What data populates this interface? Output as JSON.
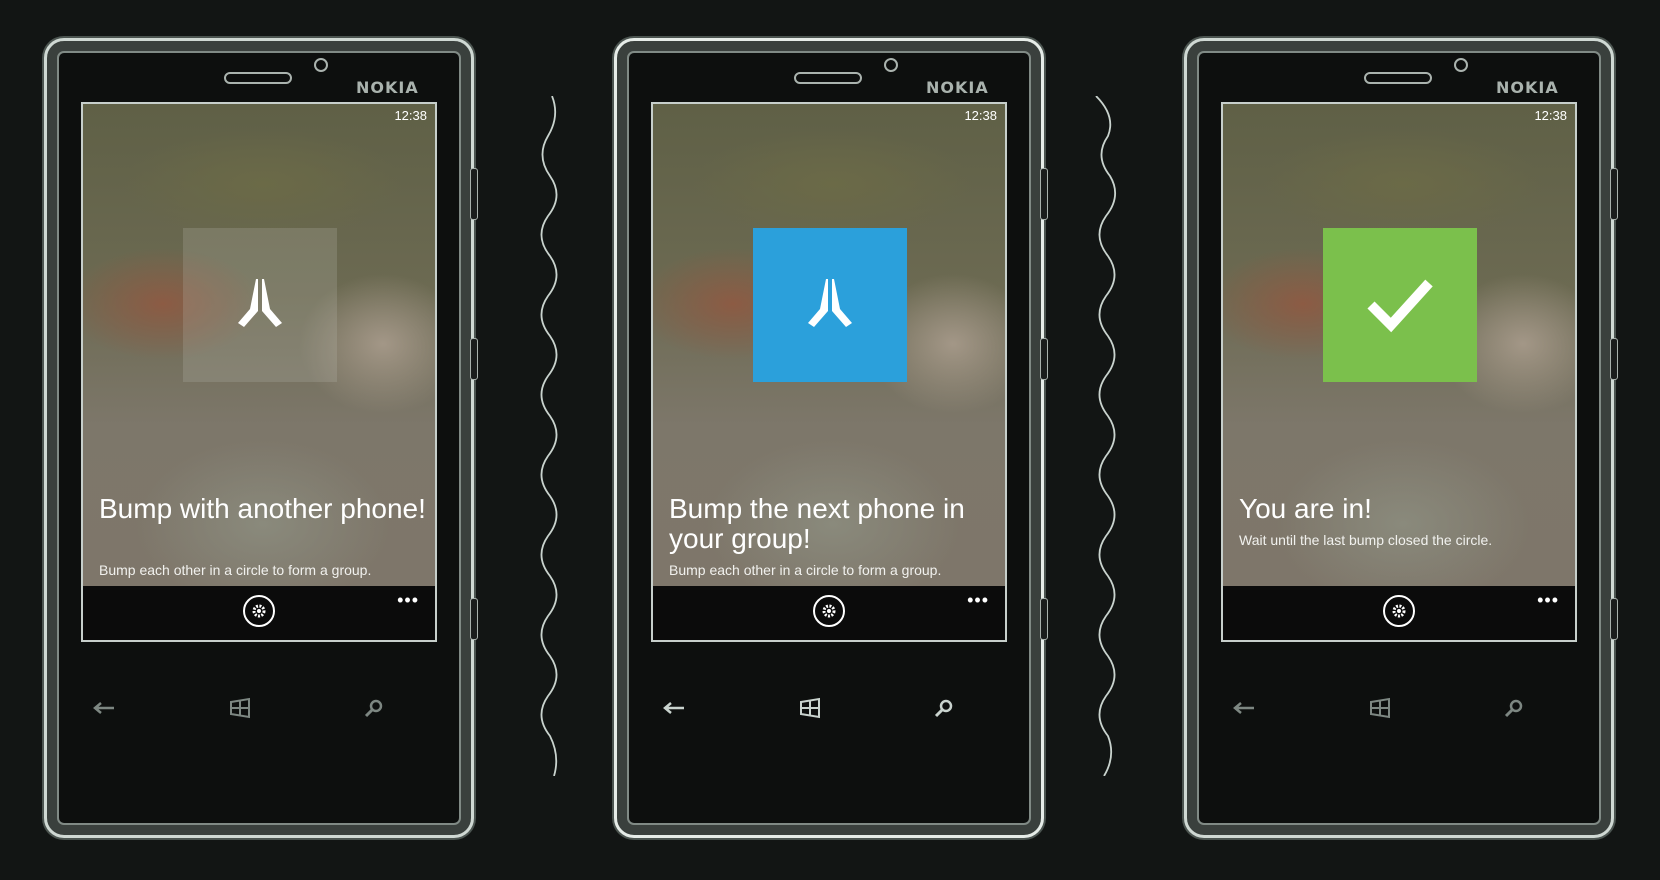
{
  "phones": [
    {
      "brand": "NOKIA",
      "time": "12:38",
      "tile_state": "neutral",
      "tile_icon": "hands-bump-icon",
      "headline": "Bump with another phone!",
      "subtext": "Bump each other in a circle to form a group.",
      "more_label": "•••"
    },
    {
      "brand": "NOKIA",
      "time": "12:38",
      "tile_state": "blue",
      "tile_icon": "hands-bump-icon",
      "headline": "Bump the next phone in your group!",
      "subtext": "Bump each other in a circle to form a group.",
      "more_label": "•••"
    },
    {
      "brand": "NOKIA",
      "time": "12:38",
      "tile_state": "green",
      "tile_icon": "checkmark-icon",
      "headline": "You are in!",
      "subtext": "Wait until the last bump closed the circle.",
      "more_label": "•••"
    }
  ],
  "colors": {
    "tile_blue": "#2ba0db",
    "tile_green": "#7bc04c",
    "background": "#121514"
  },
  "icons": [
    "hands-bump-icon",
    "checkmark-icon",
    "settings-icon",
    "back-icon",
    "windows-icon",
    "search-icon"
  ]
}
